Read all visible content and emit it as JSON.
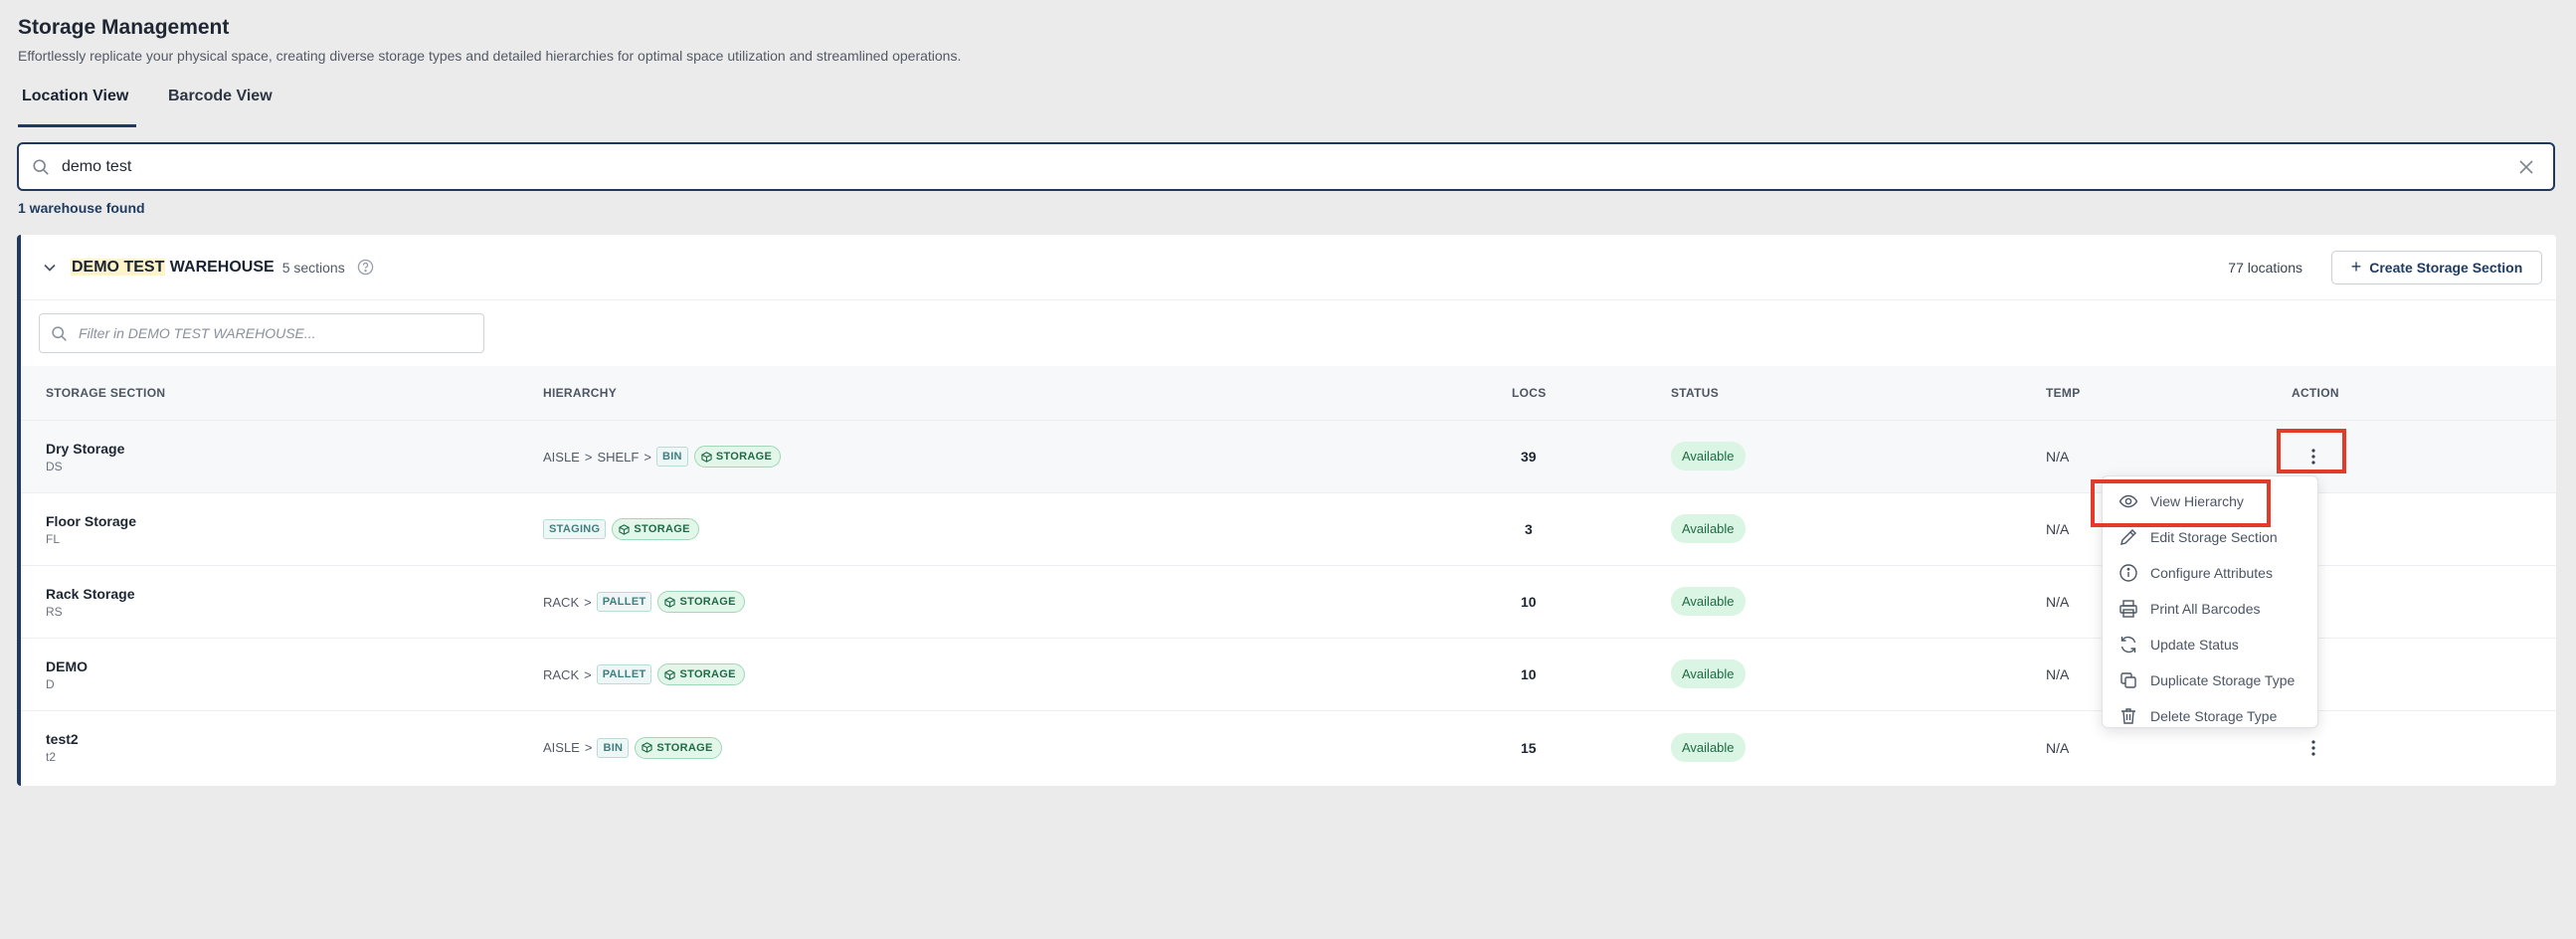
{
  "header": {
    "title": "Storage Management",
    "subtitle": "Effortlessly replicate your physical space, creating diverse storage types and detailed hierarchies for optimal space utilization and streamlined operations."
  },
  "tabs": [
    {
      "label": "Location View",
      "active": true
    },
    {
      "label": "Barcode View",
      "active": false
    }
  ],
  "search": {
    "value": "demo test",
    "icon": "search-icon",
    "clear_icon": "close-icon"
  },
  "results_text": "1 warehouse found",
  "warehouse": {
    "name_highlight": "DEMO TEST",
    "name_rest": " WAREHOUSE",
    "sections_text": "5 sections",
    "locations_text": "77 locations",
    "create_button": "Create Storage Section",
    "filter_placeholder": "Filter in DEMO TEST WAREHOUSE..."
  },
  "table": {
    "headers": [
      "STORAGE SECTION",
      "HIERARCHY",
      "LOCS",
      "STATUS",
      "TEMP",
      "ACTION"
    ],
    "rows": [
      {
        "name": "Dry Storage",
        "code": "DS",
        "hierarchy_text": [
          "AISLE",
          "SHELF"
        ],
        "hierarchy_chip": "BIN",
        "storage_chip": "STORAGE",
        "locs": "39",
        "status": "Available",
        "temp": "N/A"
      },
      {
        "name": "Floor Storage",
        "code": "FL",
        "hierarchy_text": [],
        "hierarchy_chip": "STAGING",
        "storage_chip": "STORAGE",
        "locs": "3",
        "status": "Available",
        "temp": "N/A"
      },
      {
        "name": "Rack Storage",
        "code": "RS",
        "hierarchy_text": [
          "RACK"
        ],
        "hierarchy_chip": "PALLET",
        "storage_chip": "STORAGE",
        "locs": "10",
        "status": "Available",
        "temp": "N/A"
      },
      {
        "name": "DEMO",
        "code": "D",
        "hierarchy_text": [
          "RACK"
        ],
        "hierarchy_chip": "PALLET",
        "storage_chip": "STORAGE",
        "locs": "10",
        "status": "Available",
        "temp": "N/A"
      },
      {
        "name": "test2",
        "code": "t2",
        "hierarchy_text": [
          "AISLE"
        ],
        "hierarchy_chip": "BIN",
        "storage_chip": "STORAGE",
        "locs": "15",
        "status": "Available",
        "temp": "N/A"
      }
    ],
    "separator": ">"
  },
  "action_menu": {
    "items": [
      {
        "label": "View Hierarchy",
        "icon": "eye-icon"
      },
      {
        "label": "Edit Storage Section",
        "icon": "pencil-icon"
      },
      {
        "label": "Configure Attributes",
        "icon": "info-icon"
      },
      {
        "label": "Print All Barcodes",
        "icon": "printer-icon"
      },
      {
        "label": "Update Status",
        "icon": "refresh-icon"
      },
      {
        "label": "Duplicate Storage Type",
        "icon": "copy-icon"
      },
      {
        "label": "Delete Storage Type",
        "icon": "trash-icon"
      }
    ]
  },
  "colors": {
    "accent": "#1e3a5f",
    "highlight_box": "#e23b2a",
    "status_green": "#daf5e3"
  }
}
